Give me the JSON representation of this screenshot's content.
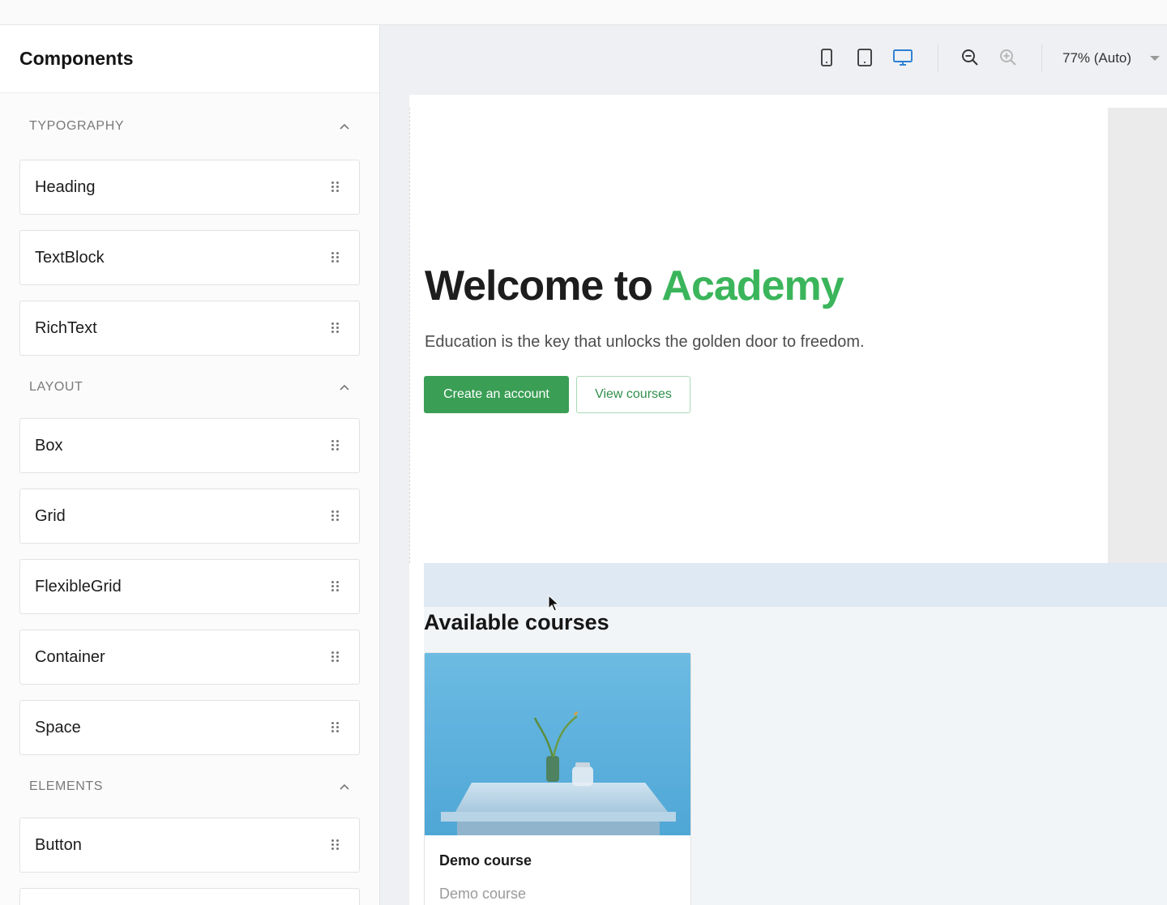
{
  "sidebar": {
    "title": "Components",
    "sections": [
      {
        "label": "TYPOGRAPHY",
        "items": [
          "Heading",
          "TextBlock",
          "RichText"
        ]
      },
      {
        "label": "LAYOUT",
        "items": [
          "Box",
          "Grid",
          "FlexibleGrid",
          "Container",
          "Space"
        ]
      },
      {
        "label": "ELEMENTS",
        "items": [
          "Button"
        ]
      }
    ]
  },
  "toolbar": {
    "devices": [
      "mobile-icon",
      "tablet-icon",
      "desktop-icon"
    ],
    "active_device": "desktop-icon",
    "zoom": "77% (Auto)"
  },
  "hero": {
    "title_prefix": "Welcome to ",
    "title_accent": "Academy",
    "subtitle": "Education is the key that unlocks the golden door to freedom.",
    "primary_button": "Create an account",
    "secondary_button": "View courses"
  },
  "courses": {
    "title": "Available courses",
    "items": [
      {
        "name": "Demo course",
        "description": "Demo course"
      }
    ]
  },
  "colors": {
    "accent": "#3bb55b",
    "primary_button": "#3a9e55",
    "active_device": "#2b7fd4",
    "drop_zone": "#dfe9f3"
  }
}
